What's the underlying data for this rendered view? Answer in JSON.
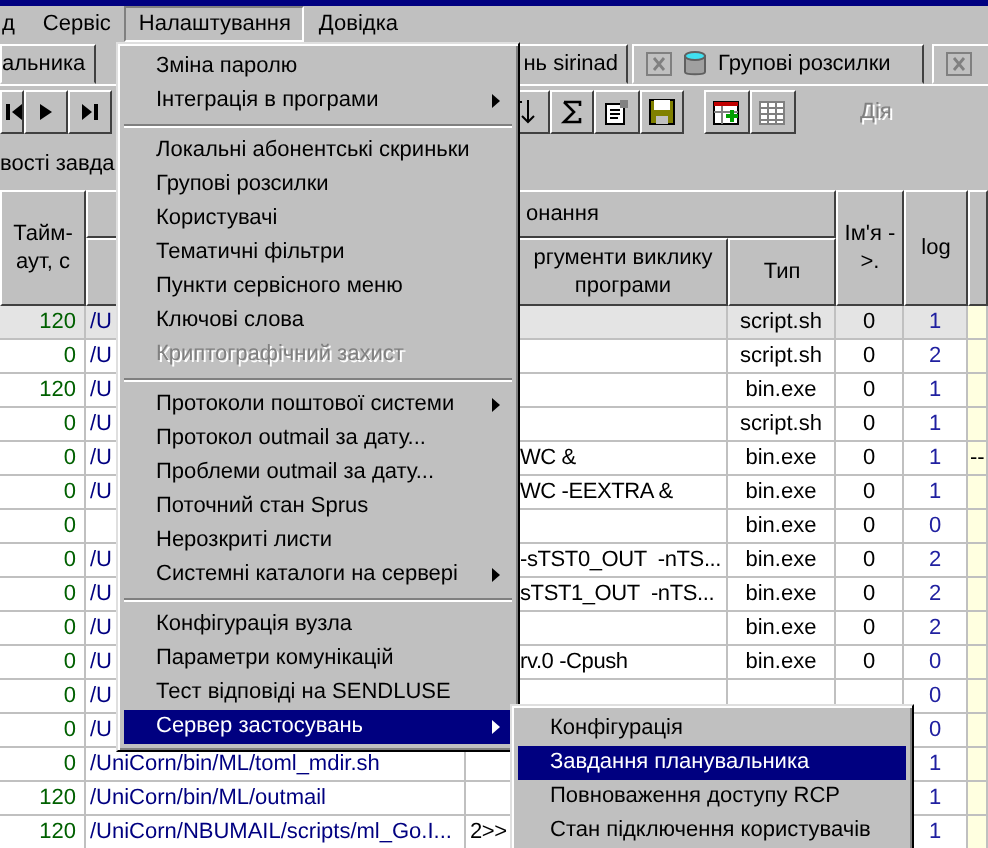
{
  "menubar": [
    {
      "label": "д",
      "selected": false
    },
    {
      "label": "Сервіс",
      "selected": false
    },
    {
      "label": "Налаштування",
      "selected": true
    },
    {
      "label": "Довідка",
      "selected": false
    }
  ],
  "tabs": [
    {
      "label": "альника",
      "kind": "text"
    },
    {
      "label": "нь sirinad",
      "kind": "text"
    },
    {
      "label": "Групові розсилки",
      "kind": "closable"
    },
    {
      "kind": "closable-cut"
    }
  ],
  "nav_buttons": [
    {
      "kind": "first"
    },
    {
      "kind": "next"
    },
    {
      "kind": "last"
    }
  ],
  "tool_buttons": [
    {
      "kind": "sort"
    },
    {
      "kind": "sum"
    },
    {
      "kind": "properties"
    },
    {
      "kind": "save"
    },
    {
      "kind": "add-table"
    },
    {
      "kind": "delete-table"
    }
  ],
  "action": {
    "label": "Дія",
    "disabled": true
  },
  "section_label": "вості завда",
  "table": {
    "columns": [
      {
        "label": "Тайм-аут, с"
      },
      {
        "label": "онання"
      },
      {
        "label": "ргументи виклику програми"
      },
      {
        "label": "Тип"
      },
      {
        "label": "Ім'я ->."
      },
      {
        "label": "log"
      }
    ],
    "rows": [
      {
        "timeout": "120",
        "path": "/U",
        "type": "script.sh",
        "name": "0",
        "log": "1",
        "selected": true
      },
      {
        "timeout": "0",
        "path": "/U",
        "type": "script.sh",
        "name": "0",
        "log": "2",
        "selected": false
      },
      {
        "timeout": "120",
        "path": "/U",
        "type": "bin.exe",
        "name": "0",
        "log": "1",
        "selected": false
      },
      {
        "timeout": "0",
        "path": "/U",
        "type": "script.sh",
        "name": "0",
        "log": "1",
        "selected": false
      },
      {
        "timeout": "0",
        "path": "/U",
        "args": "WC &",
        "type": "bin.exe",
        "name": "0",
        "log": "1",
        "column_7": "--",
        "selected": false
      },
      {
        "timeout": "0",
        "path": "/U",
        "args": "WC -EEXTRA &",
        "type": "bin.exe",
        "name": "0",
        "log": "1",
        "selected": false
      },
      {
        "timeout": "0",
        "type": "bin.exe",
        "name": "0",
        "log": "0",
        "selected": false
      },
      {
        "timeout": "0",
        "path": "/U",
        "args": "-sTST0_OUT  -nTS...",
        "type": "bin.exe",
        "name": "0",
        "log": "2",
        "selected": false
      },
      {
        "timeout": "0",
        "path": "/U",
        "args": "sTST1_OUT  -nTS...",
        "type": "bin.exe",
        "name": "0",
        "log": "2",
        "selected": false
      },
      {
        "timeout": "0",
        "path": "/U",
        "type": "bin.exe",
        "name": "0",
        "log": "2",
        "selected": false
      },
      {
        "timeout": "0",
        "path": "/U",
        "args": "rv.0 -Cpush",
        "type": "bin.exe",
        "name": "0",
        "log": "0",
        "selected": false
      },
      {
        "timeout": "0",
        "path": "/U",
        "log": "0",
        "selected": false
      },
      {
        "timeout": "0",
        "path": "/U",
        "log": "0",
        "selected": false
      },
      {
        "timeout": "0",
        "path": "/UniCorn/bin/ML/toml_mdir.sh",
        "log": "1",
        "selected": false
      },
      {
        "timeout": "120",
        "path": "/UniCorn/bin/ML/outmail",
        "log": "1",
        "selected": false
      },
      {
        "timeout": "120",
        "path": "/UniCorn/NBUMAIL/scripts/ml_Go.I...",
        "args": "2>>",
        "log": "1",
        "selected": false
      }
    ]
  },
  "menu": [
    {
      "kind": "item",
      "label": "Зміна паролю",
      "disabled": false,
      "submenu": false,
      "selected": false
    },
    {
      "kind": "item",
      "label": "Інтеграція в програми",
      "disabled": false,
      "submenu": true,
      "selected": false
    },
    {
      "kind": "separator"
    },
    {
      "kind": "item",
      "label": "Локальні абонентські скриньки",
      "disabled": false,
      "submenu": false,
      "selected": false
    },
    {
      "kind": "item",
      "label": "Групові розсилки",
      "disabled": false,
      "submenu": false,
      "selected": false
    },
    {
      "kind": "item",
      "label": "Користувачі",
      "disabled": false,
      "submenu": false,
      "selected": false
    },
    {
      "kind": "item",
      "label": "Тематичні фільтри",
      "disabled": false,
      "submenu": false,
      "selected": false
    },
    {
      "kind": "item",
      "label": "Пункти сервісного меню",
      "disabled": false,
      "submenu": false,
      "selected": false
    },
    {
      "kind": "item",
      "label": "Ключові слова",
      "disabled": false,
      "submenu": false,
      "selected": false
    },
    {
      "kind": "item",
      "label": "Криптографічний захист",
      "disabled": true,
      "submenu": false,
      "selected": false
    },
    {
      "kind": "separator"
    },
    {
      "kind": "item",
      "label": "Протоколи поштової системи",
      "disabled": false,
      "submenu": true,
      "selected": false
    },
    {
      "kind": "item",
      "label": "Протокол outmail за дату...",
      "disabled": false,
      "submenu": false,
      "selected": false
    },
    {
      "kind": "item",
      "label": "Проблеми outmail за дату...",
      "disabled": false,
      "submenu": false,
      "selected": false
    },
    {
      "kind": "item",
      "label": "Поточний стан Sprus",
      "disabled": false,
      "submenu": false,
      "selected": false
    },
    {
      "kind": "item",
      "label": "Нерозкриті листи",
      "disabled": false,
      "submenu": false,
      "selected": false
    },
    {
      "kind": "item",
      "label": "Системні каталоги на сервері",
      "disabled": false,
      "submenu": true,
      "selected": false
    },
    {
      "kind": "separator"
    },
    {
      "kind": "item",
      "label": "Конфігурація вузла",
      "disabled": false,
      "submenu": false,
      "selected": false
    },
    {
      "kind": "item",
      "label": "Параметри комунікацій",
      "disabled": false,
      "submenu": false,
      "selected": false
    },
    {
      "kind": "item",
      "label": "Тест відповіді на SENDLUSE",
      "disabled": false,
      "submenu": false,
      "selected": false
    },
    {
      "kind": "item",
      "label": "Сервер застосувань",
      "disabled": false,
      "submenu": true,
      "selected": true
    }
  ],
  "submenu": [
    {
      "label": "Конфігурація",
      "selected": false
    },
    {
      "label": "Завдання планувальника",
      "selected": true
    },
    {
      "label": "Повноваження доступу RCP",
      "selected": false
    },
    {
      "label": "Стан підключення користувачів",
      "selected": false
    }
  ]
}
